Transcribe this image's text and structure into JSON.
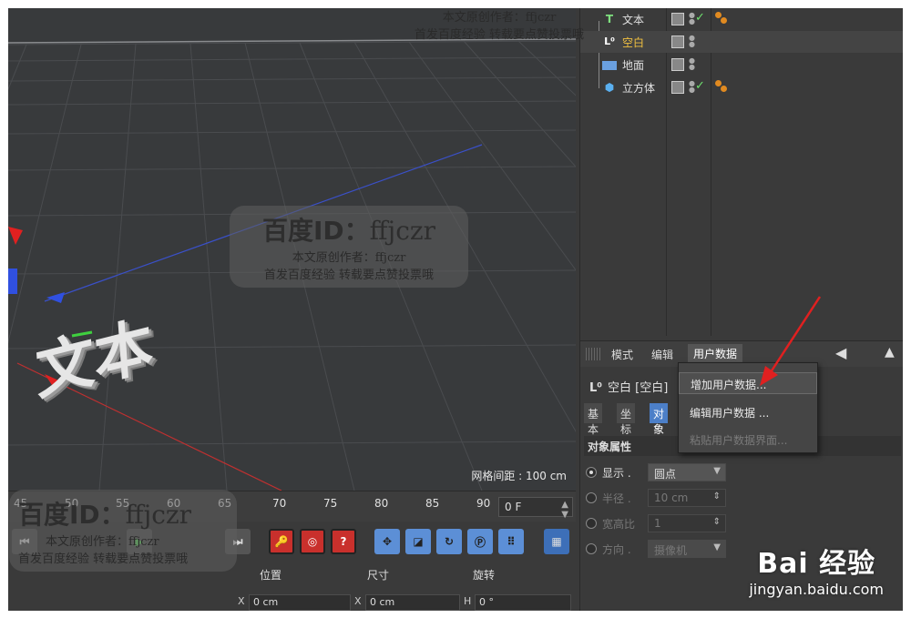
{
  "viewport": {
    "grid_spacing": "网格间距 : 100 cm",
    "object_3d_text": "文本"
  },
  "timeline": {
    "ruler": [
      "45",
      "50",
      "55",
      "60",
      "65",
      "70",
      "75",
      "80",
      "85",
      "90"
    ],
    "current_frame": "0 F"
  },
  "coords": {
    "headers": [
      "位置",
      "尺寸",
      "旋转"
    ],
    "fields": [
      {
        "axis": "X",
        "value": "0 cm"
      },
      {
        "axis": "X",
        "value": "0 cm"
      },
      {
        "axis": "H",
        "value": "0 °"
      }
    ]
  },
  "objects": [
    {
      "name": "文本",
      "icon": "T",
      "icon_color": "#7fe07f",
      "highlighted": false,
      "has_check": true,
      "has_tag": true
    },
    {
      "name": "空白",
      "icon": "L0",
      "icon_color": "#ffffff",
      "highlighted": true,
      "has_check": false,
      "has_tag": false
    },
    {
      "name": "地面",
      "icon": "floor",
      "icon_color": "#6aa0e0",
      "highlighted": false,
      "has_check": false,
      "has_tag": false
    },
    {
      "name": "立方体",
      "icon": "cube",
      "icon_color": "#5ab0f0",
      "highlighted": false,
      "has_check": true,
      "has_tag": true
    }
  ],
  "attr": {
    "menu": [
      "模式",
      "编辑",
      "用户数据"
    ],
    "object_title": "空白 [空白]",
    "tabs": [
      "基本",
      "坐标",
      "对象"
    ],
    "section": "对象属性",
    "props": [
      {
        "label": "显示 .",
        "value": "圆点",
        "enabled": true
      },
      {
        "label": "半径 .",
        "value": "10 cm",
        "enabled": false
      },
      {
        "label": "宽高比",
        "value": "1",
        "enabled": false
      },
      {
        "label": "方向 .",
        "value": "摄像机",
        "enabled": false
      }
    ]
  },
  "dropdown": {
    "items": [
      "增加用户数据...",
      "编辑用户数据 ...",
      "粘贴用户数据界面..."
    ]
  },
  "watermark": {
    "title_prefix": "百度ID：",
    "title_id": "ffjczr",
    "line1": "本文原创作者：ffjczr",
    "line2": "首发百度经验 转载要点赞投票哦",
    "top_line1": "本文原创作者：ffjczr",
    "top_line2": "首发百度经验 转载要点赞投票哦",
    "bottom_line1": "本文原创作者：ffjczr",
    "bottom_line2": "首发百度经验 转载要点赞投票哦"
  },
  "brand": {
    "logo": "Bai 经验",
    "url": "jingyan.baidu.com"
  },
  "colors": {
    "accent_blue": "#4c7fc8",
    "arrow_red": "#e02020",
    "tag_orange": "#e08a20"
  }
}
